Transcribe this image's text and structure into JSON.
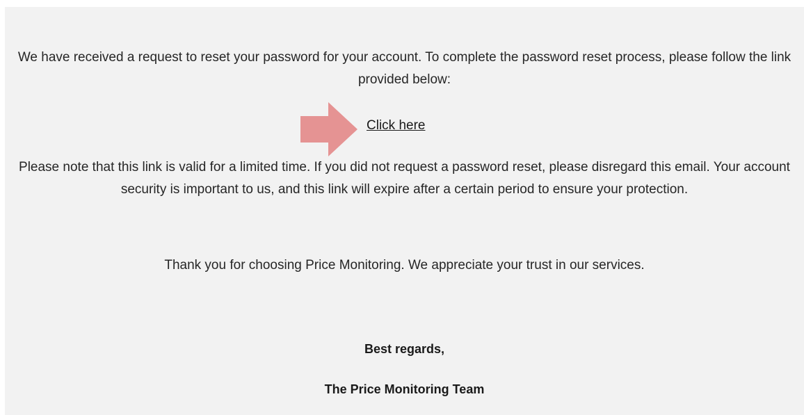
{
  "email": {
    "intro_text": "We have received a request to reset your password for your account. To complete the password reset process, please follow the link provided below:",
    "link_label": "Click here",
    "note_text": "Please note that this link is valid for a limited time. If you did not request a password reset, please disregard this email. Your account security is important to us, and this link will expire after a certain period to ensure your protection.",
    "thanks_text": "Thank you for choosing Price Monitoring. We appreciate your trust in our services.",
    "regards": "Best regards,",
    "team": "The Price Monitoring Team"
  },
  "colors": {
    "panel_background": "#f2f2f2",
    "arrow": "#e59393",
    "text": "#262626"
  },
  "icons": {
    "pointer": "right-arrow-icon"
  }
}
